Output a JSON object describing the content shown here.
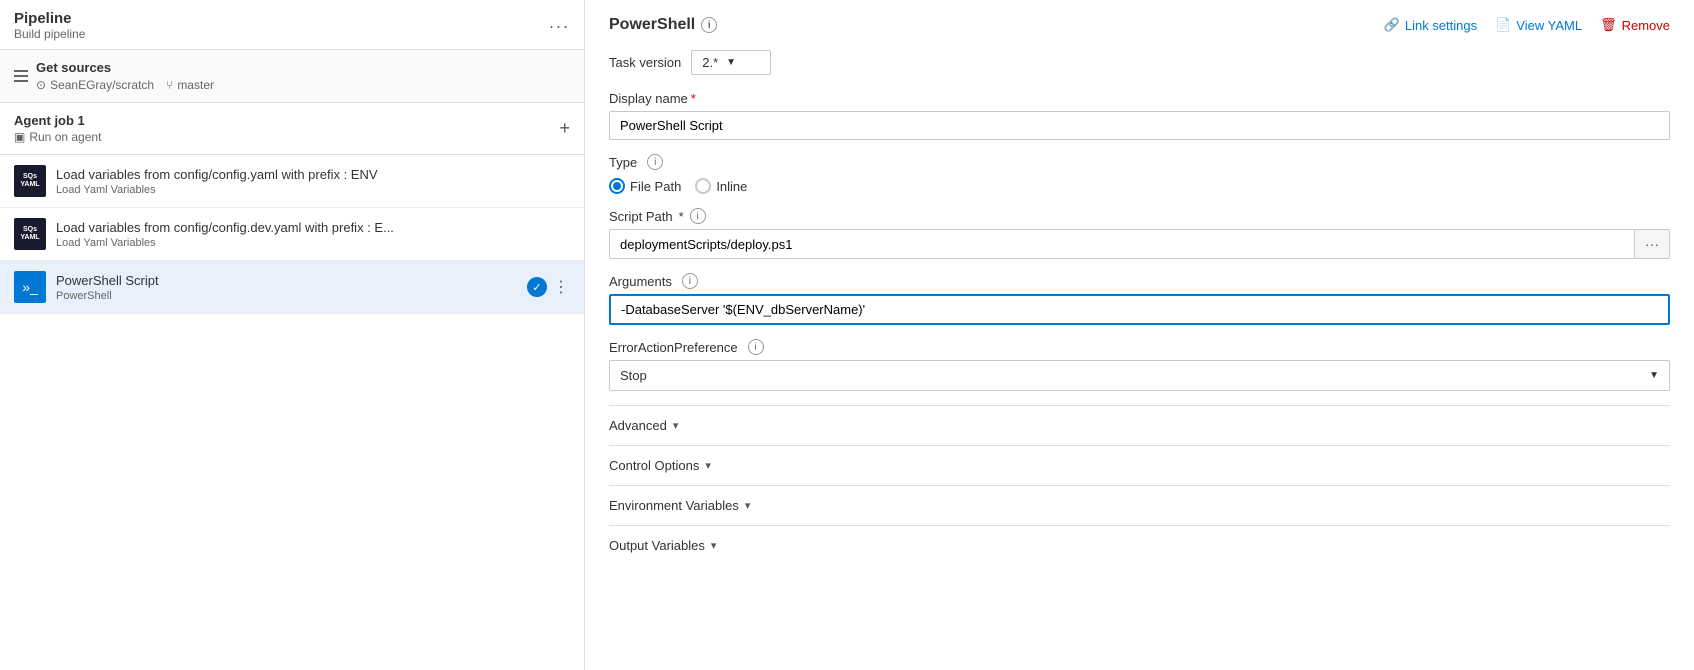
{
  "left": {
    "pipeline": {
      "title": "Pipeline",
      "subtitle": "Build pipeline",
      "dots": "..."
    },
    "get_sources": {
      "title": "Get sources",
      "repo": "SeanEGray/scratch",
      "branch": "master"
    },
    "agent_job": {
      "title": "Agent job 1",
      "subtitle": "Run on agent",
      "plus": "+"
    },
    "tasks": [
      {
        "id": "task1",
        "name": "Load variables from config/config.yaml with prefix : ENV",
        "type": "Load Yaml Variables",
        "icon_text": "SQs\nYAML",
        "icon_type": "yaml",
        "selected": false
      },
      {
        "id": "task2",
        "name": "Load variables from config/config.dev.yaml with prefix : E...",
        "type": "Load Yaml Variables",
        "icon_text": "SQs\nYAML",
        "icon_type": "yaml",
        "selected": false
      },
      {
        "id": "task3",
        "name": "PowerShell Script",
        "type": "PowerShell",
        "icon_text": ">_",
        "icon_type": "ps",
        "selected": true
      }
    ]
  },
  "right": {
    "title": "PowerShell",
    "actions": {
      "link_settings": "Link settings",
      "view_yaml": "View YAML",
      "remove": "Remove"
    },
    "task_version": {
      "label": "Task version",
      "value": "2.*"
    },
    "display_name": {
      "label": "Display name",
      "required": "*",
      "value": "PowerShell Script"
    },
    "type": {
      "label": "Type",
      "options": [
        {
          "value": "filepath",
          "label": "File Path",
          "selected": true
        },
        {
          "value": "inline",
          "label": "Inline",
          "selected": false
        }
      ]
    },
    "script_path": {
      "label": "Script Path",
      "required": "*",
      "value": "deploymentScripts/deploy.ps1",
      "placeholder": "deploymentScripts/deploy.ps1"
    },
    "arguments": {
      "label": "Arguments",
      "value": "-DatabaseServer '$(ENV_dbServerName)'"
    },
    "error_action_preference": {
      "label": "ErrorActionPreference",
      "value": "Stop"
    },
    "sections": {
      "advanced": "Advanced",
      "control_options": "Control Options",
      "environment_variables": "Environment Variables",
      "output_variables": "Output Variables"
    }
  }
}
